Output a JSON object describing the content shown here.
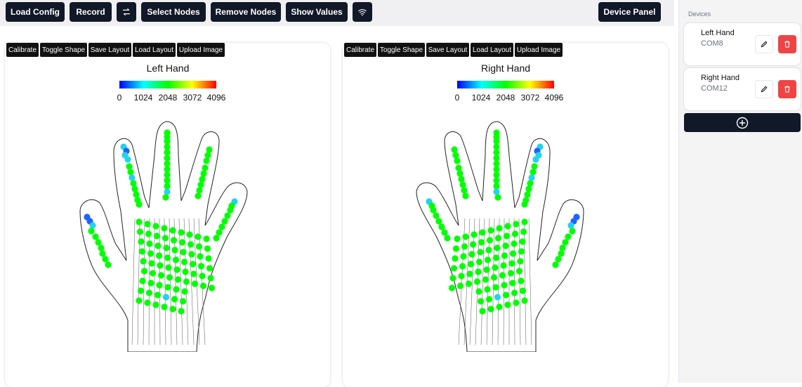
{
  "toolbar": {
    "load_config": "Load Config",
    "record": "Record",
    "swap_icon": "swap-arrows-icon",
    "select_nodes": "Select Nodes",
    "remove_nodes": "Remove Nodes",
    "show_values": "Show Values",
    "wifi_icon": "wifi-icon",
    "device_panel": "Device Panel"
  },
  "panels": [
    {
      "title": "Left Hand",
      "buttons": [
        "Calibrate",
        "Toggle Shape",
        "Save Layout",
        "Load Layout",
        "Upload Image"
      ],
      "scale_ticks": [
        "0",
        "1024",
        "2048",
        "3072",
        "4096"
      ]
    },
    {
      "title": "Right Hand",
      "buttons": [
        "Calibrate",
        "Toggle Shape",
        "Save Layout",
        "Load Layout",
        "Upload Image"
      ],
      "scale_ticks": [
        "0",
        "1024",
        "2048",
        "3072",
        "4096"
      ]
    }
  ],
  "colors": {
    "accent_dark": "#111827",
    "node_green": "#00ff00",
    "node_cyan": "#22d3ee",
    "node_blue": "#1e63ff",
    "delete_red": "#ef4444"
  },
  "sidebar": {
    "title": "Devices",
    "devices": [
      {
        "name": "Left Hand",
        "port": "COM8",
        "edit_icon": "pencil-icon",
        "delete_icon": "trash-icon"
      },
      {
        "name": "Right Hand",
        "port": "COM12",
        "edit_icon": "pencil-icon",
        "delete_icon": "trash-icon"
      }
    ],
    "add_icon": "plus-circle-icon"
  }
}
